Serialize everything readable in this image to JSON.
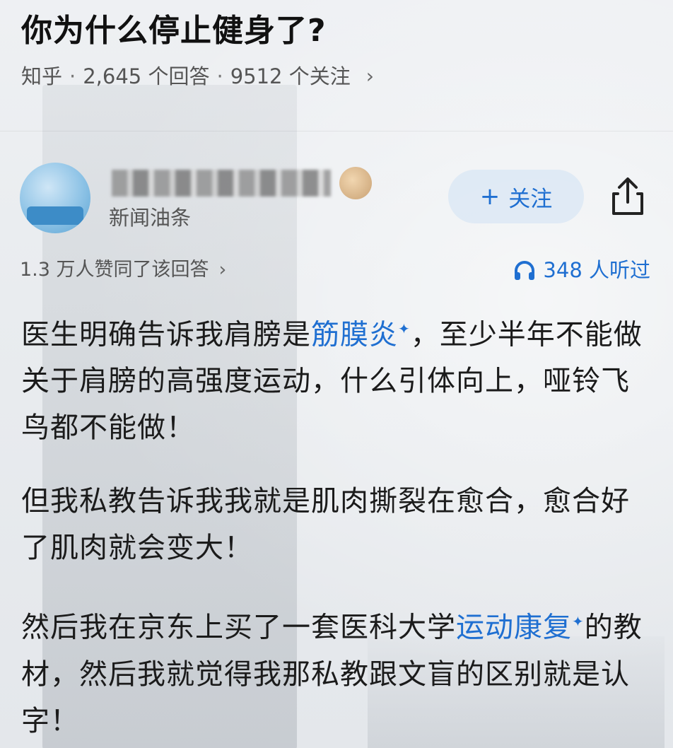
{
  "question": {
    "title": "你为什么停止健身了?",
    "source": "知乎",
    "answers": "2,645 个回答",
    "followers": "9512 个关注",
    "chevron": "›"
  },
  "author": {
    "description": "新闻油条",
    "follow_label": "关注",
    "follow_icon": "plus-icon",
    "share_icon": "share-icon"
  },
  "stats": {
    "agree": "1.3 万人赞同了该回答",
    "listened": "348 人听过",
    "listen_icon": "headphones-icon"
  },
  "answer": {
    "p1": {
      "a": "医生明确告诉我肩膀是",
      "link": "筋膜炎",
      "b": "，至少半年不能做关于肩膀的高强度运动，什么引体向上，哑铃飞鸟都不能做！"
    },
    "p2": "但我私教告诉我我就是肌肉撕裂在愈合，愈合好了肌肉就会变大！",
    "p3": {
      "a": "然后我在京东上买了一套医科大学",
      "link": "运动康复",
      "b": "的教材，然后我就觉得我那私教跟文盲的区别就是认字！"
    }
  },
  "colors": {
    "link": "#1f6fd1",
    "text": "#1b1b1b",
    "meta": "#555555"
  }
}
